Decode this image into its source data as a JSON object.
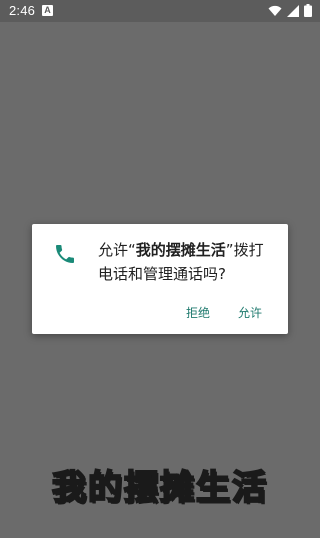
{
  "status_bar": {
    "time": "2:46",
    "notification_icon_letter": "A",
    "icons": [
      "wifi-icon",
      "signal-icon",
      "battery-icon"
    ]
  },
  "dialog": {
    "icon": "phone-icon",
    "message_prefix": "允许“",
    "app_name": "我的摆摊生活",
    "message_suffix": "”拨打电话和管理通话吗?",
    "deny_label": "拒绝",
    "allow_label": "允许",
    "accent_color": "#1f7a6e",
    "icon_color": "#1a8a78"
  },
  "background": {
    "title": "我的摆摊生活"
  }
}
